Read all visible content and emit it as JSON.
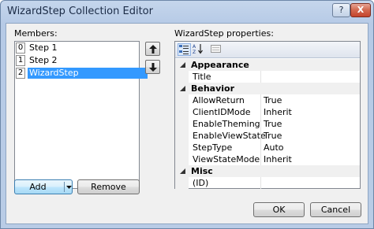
{
  "window": {
    "title": "WizardStep Collection Editor",
    "help_glyph": "?",
    "close_glyph": "X"
  },
  "members": {
    "label": "Members:",
    "items": [
      {
        "index": "0",
        "label": "Step 1",
        "selected": false
      },
      {
        "index": "1",
        "label": "Step 2",
        "selected": false
      },
      {
        "index": "2",
        "label": "WizardStep",
        "selected": true
      }
    ]
  },
  "properties": {
    "label": "WizardStep properties:",
    "toolbar": [
      "categorized-icon",
      "alphabetical-icon",
      "property-pages-icon"
    ],
    "categories": [
      {
        "name": "Appearance",
        "props": [
          {
            "name": "Title",
            "value": ""
          }
        ]
      },
      {
        "name": "Behavior",
        "props": [
          {
            "name": "AllowReturn",
            "value": "True"
          },
          {
            "name": "ClientIDMode",
            "value": "Inherit"
          },
          {
            "name": "EnableTheming",
            "value": "True"
          },
          {
            "name": "EnableViewState",
            "value": "True"
          },
          {
            "name": "StepType",
            "value": "Auto"
          },
          {
            "name": "ViewStateMode",
            "value": "Inherit"
          }
        ]
      },
      {
        "name": "Misc",
        "props": [
          {
            "name": "(ID)",
            "value": ""
          }
        ]
      }
    ]
  },
  "buttons": {
    "add": "Add",
    "remove": "Remove",
    "ok": "OK",
    "cancel": "Cancel"
  },
  "icons": {
    "move_up": "arrow-up-icon",
    "move_down": "arrow-down-icon",
    "add_dropdown": "chevron-down-icon"
  },
  "colors": {
    "selection": "#3399ff",
    "title_bar": "#c5d6ec",
    "dialog_bg": "#f0f0f0"
  }
}
